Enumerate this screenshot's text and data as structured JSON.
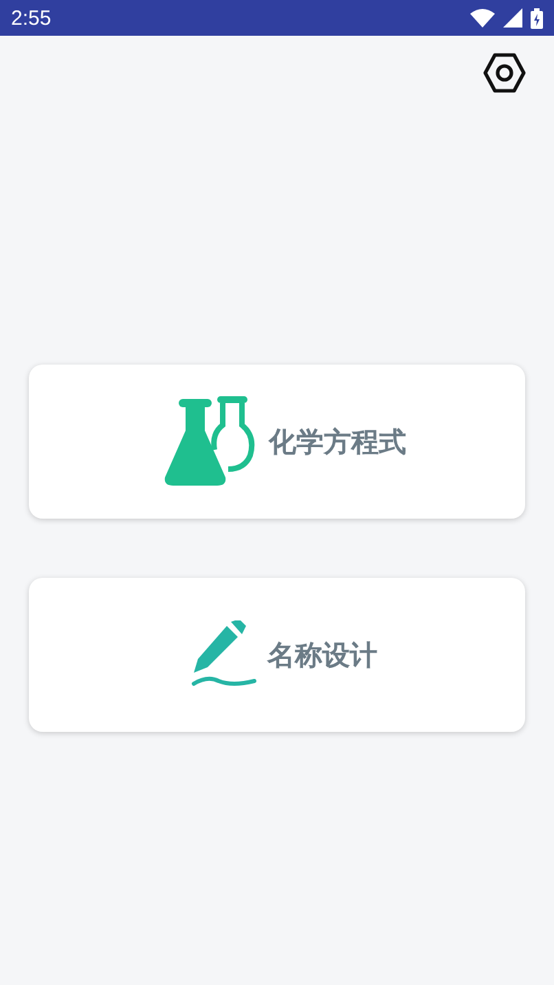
{
  "status_bar": {
    "time": "2:55"
  },
  "cards": [
    {
      "kind": "flask",
      "label": "化学方程式"
    },
    {
      "kind": "pen",
      "label": "名称设计"
    }
  ]
}
